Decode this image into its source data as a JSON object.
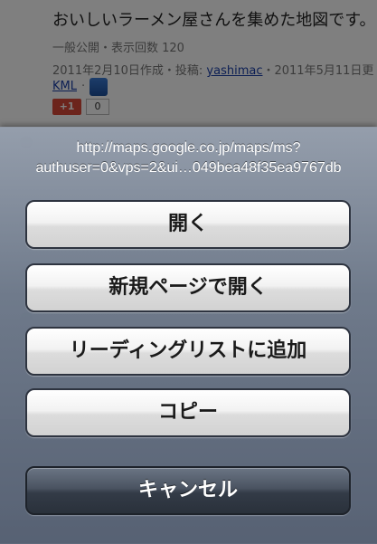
{
  "background_page": {
    "title": "おいしいラーメン屋さんを集めた地図です。",
    "meta_line": "一般公開・表示回数 120",
    "created_prefix": "2011年2月10日作成・投稿: ",
    "author": "yashimac",
    "created_suffix": "・2011年5月11日更",
    "kml_link": "KML",
    "separator": "·",
    "gplus_label": "+1",
    "gplus_count": "0"
  },
  "action_sheet": {
    "url_line1": "http://maps.google.co.jp/maps/ms?",
    "url_line2": "authuser=0&vps=2&ui…049bea48f35ea9767db",
    "buttons": {
      "open": "開く",
      "open_new_page": "新規ページで開く",
      "add_reading_list": "リーディングリストに追加",
      "copy": "コピー",
      "cancel": "キャンセル"
    }
  },
  "colors": {
    "dim_overlay": "#000000",
    "link": "#1a3fa8",
    "cancel_button": "#3a4350"
  }
}
